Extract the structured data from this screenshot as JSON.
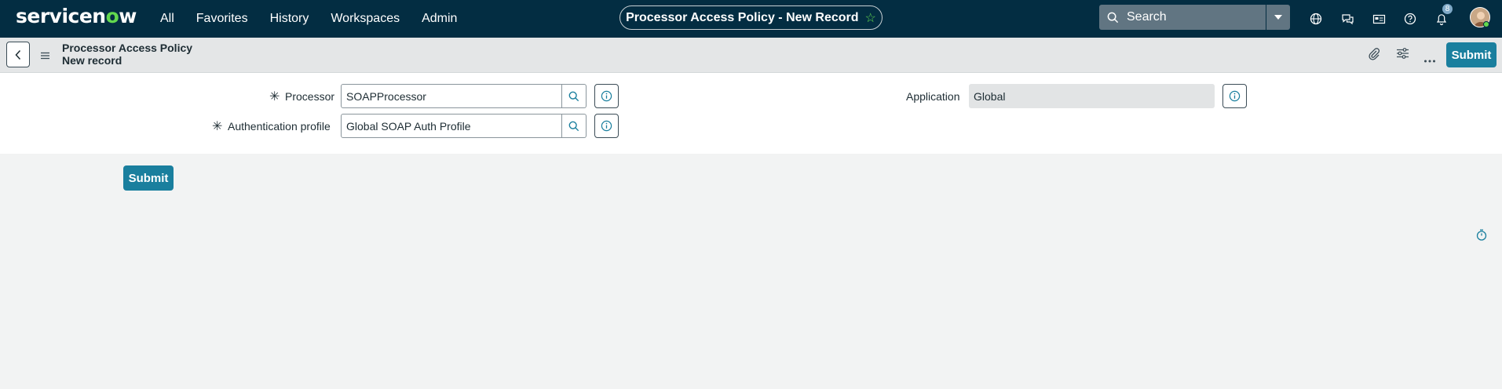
{
  "topbar": {
    "logo": {
      "part1": "servicen",
      "o": "o",
      "part2": "w"
    },
    "nav": [
      "All",
      "Favorites",
      "History",
      "Workspaces",
      "Admin"
    ],
    "title": "Processor Access Policy - New Record",
    "star_icon": "star-icon",
    "search_placeholder": "Search",
    "notification_count": "8",
    "icons": [
      "globe-icon",
      "chat-icon",
      "card-icon",
      "help-icon",
      "bell-icon",
      "avatar"
    ]
  },
  "header": {
    "title_line1": "Processor Access Policy",
    "title_line2": "New record",
    "submit_label": "Submit"
  },
  "form": {
    "processor": {
      "label": "Processor",
      "value": "SOAPProcessor",
      "required": true
    },
    "auth_profile": {
      "label": "Authentication profile",
      "value": "Global SOAP Auth Profile",
      "required": true
    },
    "application": {
      "label": "Application",
      "value": "Global"
    },
    "required_marker": "✳"
  },
  "footer": {
    "submit_label": "Submit"
  },
  "colors": {
    "topbar": "#032d42",
    "accent": "#1a7f9e",
    "brand_green": "#62d84e"
  }
}
